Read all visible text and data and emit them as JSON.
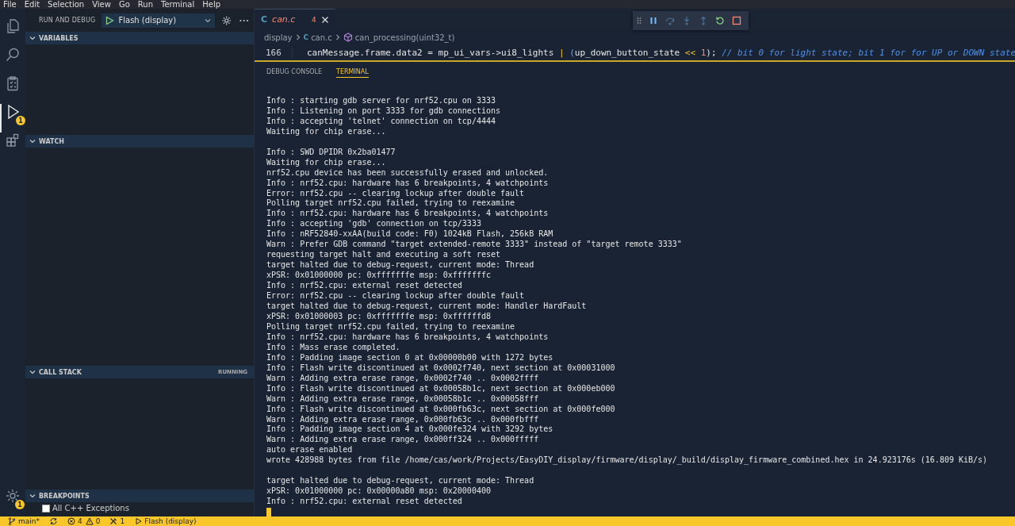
{
  "menu": [
    "File",
    "Edit",
    "Selection",
    "View",
    "Go",
    "Run",
    "Terminal",
    "Help"
  ],
  "activity_bar": [
    {
      "kind": "files",
      "selected": false
    },
    {
      "kind": "search",
      "selected": false
    },
    {
      "kind": "tests",
      "selected": false
    },
    {
      "kind": "debug",
      "selected": true,
      "badge": "1"
    },
    {
      "kind": "extensions",
      "selected": false
    }
  ],
  "settings_badge": "1",
  "sidebar": {
    "title": "RUN AND DEBUG",
    "config": "Flash (display)",
    "sections": [
      {
        "title": "VARIABLES",
        "expanded": true
      },
      {
        "title": "WATCH",
        "expanded": true
      },
      {
        "title": "CALL STACK",
        "expanded": true,
        "status": "RUNNING"
      },
      {
        "title": "BREAKPOINTS",
        "expanded": true,
        "items": [
          {
            "label": "All C++ Exceptions",
            "checked": false
          }
        ]
      }
    ]
  },
  "editor": {
    "tabs": [
      {
        "label": "can.c",
        "problems": "4",
        "selected": true
      }
    ],
    "breadcrumb": [
      "display",
      "can.c",
      "can_processing(uint32_t)"
    ],
    "line_number": "166",
    "file_icon": "C",
    "breadcrumb_file_icon": "C",
    "tokens": [
      {
        "kind": "plain",
        "text": "canMessage.frame.data2 = mp_ui_vars->ui8_lights "
      },
      {
        "kind": "operator",
        "text": "|"
      },
      {
        "kind": "bracket",
        "text": " ("
      },
      {
        "kind": "plain",
        "text": "up_down_button_state "
      },
      {
        "kind": "operator",
        "text": "<<"
      },
      {
        "kind": "number",
        "text": " 1"
      },
      {
        "kind": "plain",
        "text": "); "
      },
      {
        "kind": "comment",
        "text": "// bit 0 for light state; bit 1 for for UP or DOWN state"
      }
    ]
  },
  "debug_toolbar": [
    {
      "kind": "pause",
      "disabled": false
    },
    {
      "kind": "step-over",
      "disabled": true
    },
    {
      "kind": "step-into",
      "disabled": true
    },
    {
      "kind": "step-out",
      "disabled": true
    },
    {
      "kind": "restart",
      "disabled": false
    },
    {
      "kind": "stop",
      "disabled": false
    }
  ],
  "panel": {
    "tabs": [
      {
        "label": "DEBUG CONSOLE",
        "selected": false
      },
      {
        "label": "TERMINAL",
        "selected": true
      }
    ],
    "terminal": [
      [
        "Info : starting gdb server for nrf52.cpu on 3333",
        "Info : Listening on port 3333 for gdb connections",
        "Info : accepting 'telnet' connection on tcp/4444",
        "Waiting for chip erase..."
      ],
      [
        "Info : SWD DPIDR 0x2ba01477",
        "Waiting for chip erase...",
        "nrf52.cpu device has been successfully erased and unlocked.",
        "Info : nrf52.cpu: hardware has 6 breakpoints, 4 watchpoints",
        "Error: nrf52.cpu -- clearing lockup after double fault",
        "Polling target nrf52.cpu failed, trying to reexamine",
        "Info : nrf52.cpu: hardware has 6 breakpoints, 4 watchpoints",
        "Info : accepting 'gdb' connection on tcp/3333",
        "Info : nRF52840-xxAA(build code: F0) 1024kB Flash, 256kB RAM",
        "Warn : Prefer GDB command \"target extended-remote 3333\" instead of \"target remote 3333\"",
        "requesting target halt and executing a soft reset",
        "target halted due to debug-request, current mode: Thread",
        "xPSR: 0x01000000 pc: 0xfffffffe msp: 0xfffffffc",
        "Info : nrf52.cpu: external reset detected",
        "Error: nrf52.cpu -- clearing lockup after double fault",
        "target halted due to debug-request, current mode: Handler HardFault",
        "xPSR: 0x01000003 pc: 0xfffffffe msp: 0xffffffd8",
        "Polling target nrf52.cpu failed, trying to reexamine",
        "Info : nrf52.cpu: hardware has 6 breakpoints, 4 watchpoints",
        "Info : Mass erase completed.",
        "Info : Padding image section 0 at 0x00000b00 with 1272 bytes",
        "Info : Flash write discontinued at 0x0002f740, next section at 0x00031000",
        "Warn : Adding extra erase range, 0x0002f740 .. 0x0002ffff",
        "Info : Flash write discontinued at 0x00058b1c, next section at 0x000eb000",
        "Warn : Adding extra erase range, 0x00058b1c .. 0x00058fff",
        "Info : Flash write discontinued at 0x000fb63c, next section at 0x000fe000",
        "Warn : Adding extra erase range, 0x000fb63c .. 0x000fbfff",
        "Info : Padding image section 4 at 0x000fe324 with 3292 bytes",
        "Warn : Adding extra erase range, 0x000ff324 .. 0x000fffff",
        "auto erase enabled",
        "wrote 428988 bytes from file /home/cas/work/Projects/EasyDIY_display/firmware/display/_build/display_firmware_combined.hex in 24.923176s (16.809 KiB/s)"
      ],
      [
        "target halted due to debug-request, current mode: Thread",
        "xPSR: 0x01000000 pc: 0x00000a80 msp: 0x20000400",
        "Info : nrf52.cpu: external reset detected"
      ]
    ]
  },
  "status_bar": [
    {
      "kind": "branch",
      "text": "main*"
    },
    {
      "kind": "sync"
    },
    {
      "kind": "errors",
      "text": "4"
    },
    {
      "kind": "warnings",
      "text": "0"
    },
    {
      "kind": "tools",
      "text": "1"
    },
    {
      "kind": "launch",
      "text": "Flash (display)"
    }
  ]
}
